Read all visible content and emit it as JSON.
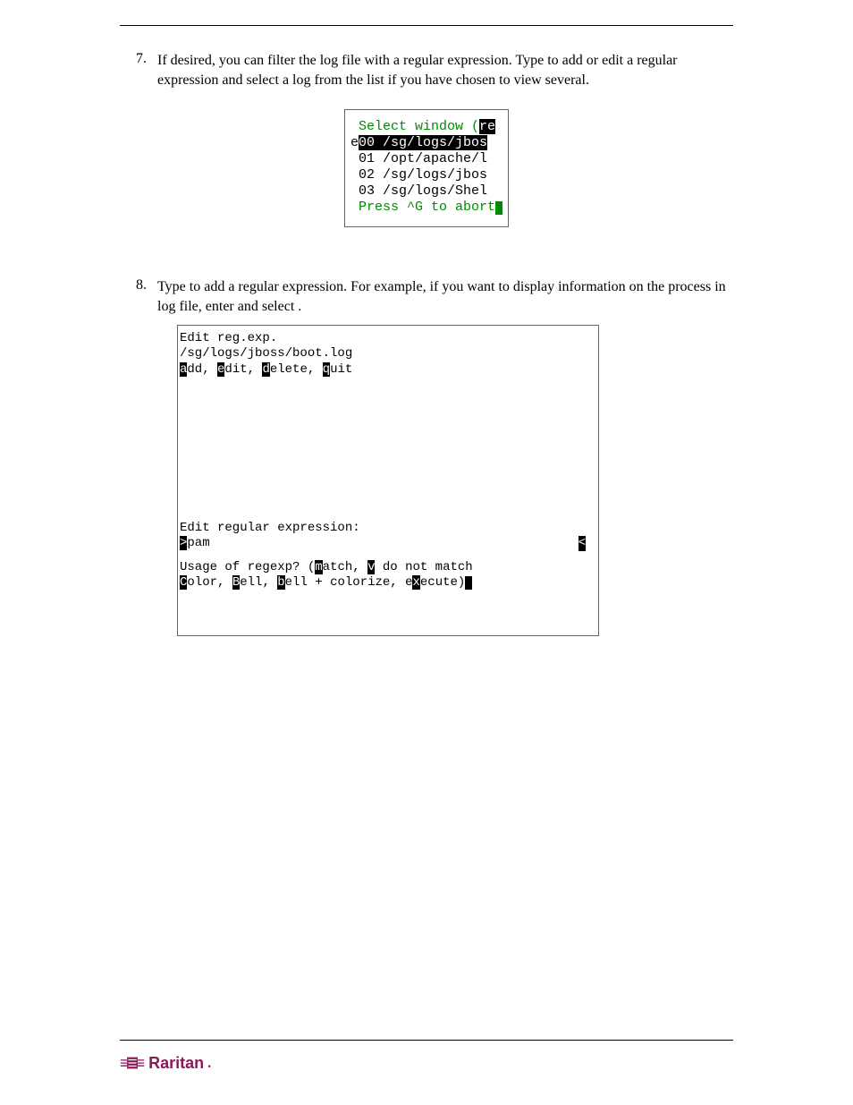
{
  "steps": {
    "s7": {
      "num": "7.",
      "text_a": "If desired, you can filter the log file with a regular expression. Type ",
      "text_b": " to add or edit a regular expression and select a log from the list if you have chosen to view several."
    },
    "s8": {
      "num": "8.",
      "text_a": "Type ",
      "text_b": " to add a regular expression. For example, if you want to display information on the ",
      "text_c": " process in ",
      "text_d": " log file, enter ",
      "text_e": " and select ",
      "text_f": "."
    }
  },
  "term1": {
    "title_pre": " Select window (",
    "title_post": "re",
    "row0_prefix": "e",
    "row0_sel": "00 /sg/logs/jbos",
    "row1": " 01 /opt/apache/l",
    "row2": " 02 /sg/logs/jbos",
    "row3": " 03 /sg/logs/Shel",
    "abort": " Press ^G to abort"
  },
  "term2": {
    "l1": "Edit reg.exp.",
    "l2": "/sg/logs/jboss/boot.log",
    "l3_a": "a",
    "l3_b": "dd, ",
    "l3_c": "e",
    "l3_d": "dit, ",
    "l3_e": "d",
    "l3_f": "elete, ",
    "l3_g": "q",
    "l3_h": "uit",
    "l4": "Edit regular expression:",
    "inp_prefix": ">",
    "inp_val": "pam",
    "inp_end": "<",
    "l5_a": "Usage of regexp? (",
    "l5_b": "m",
    "l5_c": "atch, ",
    "l5_d": "v",
    "l5_e": " do not match",
    "l6_a": "C",
    "l6_b": "olor, ",
    "l6_c": "B",
    "l6_d": "ell, ",
    "l6_e": "b",
    "l6_f": "ell + colorize, e",
    "l6_g": "x",
    "l6_h": "ecute)"
  },
  "footer": {
    "brand": "Raritan"
  }
}
